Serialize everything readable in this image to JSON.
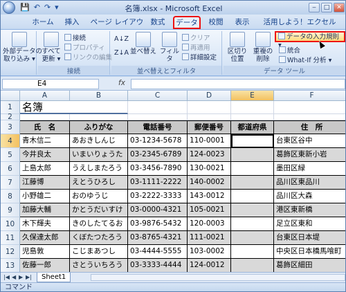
{
  "window": {
    "title": "名簿.xlsx - Microsoft Excel"
  },
  "qat": {
    "save": "💾",
    "undo": "↶",
    "redo": "↷",
    "more": "▾"
  },
  "tabs": [
    "ホーム",
    "挿入",
    "ページ レイアウト",
    "数式",
    "データ",
    "校閲",
    "表示",
    "活用しよう！エクセル"
  ],
  "active_tab_index": 4,
  "ribbon": {
    "groups": {
      "g1_label": "",
      "connections_label": "接続",
      "sort_label": "並べ替えとフィルタ",
      "tools_label": "データ ツール"
    },
    "external_data": "外部データの\n取り込み ▾",
    "refresh_all": "すべて\n更新 ▾",
    "connections": "接続",
    "properties": "プロパティ",
    "edit_links": "リンクの編集",
    "sort_az": "A↓Z",
    "sort_za": "Z↓A",
    "sort": "並べ替え",
    "filter": "フィルタ",
    "clear": "クリア",
    "reapply": "再適用",
    "advanced": "詳細設定",
    "text_to_columns": "区切り位置",
    "remove_dupes": "重複の\n削除",
    "data_validation": "データの入力規則 ▾",
    "consolidate": "統合",
    "whatif": "What-If 分析 ▾"
  },
  "formula_bar": {
    "name_box": "E4",
    "fx": "fx",
    "content": ""
  },
  "columns": [
    "A",
    "B",
    "C",
    "D",
    "E",
    "F"
  ],
  "sheet": {
    "title": "名簿",
    "headers": [
      "氏　名",
      "ふりがな",
      "電話番号",
      "郵便番号",
      "都道府県",
      "住　所"
    ],
    "rows": [
      [
        "青木信二",
        "あおきしんじ",
        "03-1234-5678",
        "110-0001",
        "",
        "台東区谷中"
      ],
      [
        "今井良太",
        "いまいりょうた",
        "03-2345-6789",
        "124-0023",
        "",
        "葛飾区東新小岩"
      ],
      [
        "上島太郎",
        "うえしまたろう",
        "03-3456-7890",
        "130-0021",
        "",
        "墨田区緑"
      ],
      [
        "江藤博",
        "えとうひろし",
        "03-1111-2222",
        "140-0002",
        "",
        "品川区東品川"
      ],
      [
        "小野雄二",
        "おのゆうじ",
        "03-2222-3333",
        "143-0012",
        "",
        "品川区大森"
      ],
      [
        "加藤大輔",
        "かとうだいすけ",
        "03-0000-4321",
        "105-0021",
        "",
        "港区東新橋"
      ],
      [
        "木下輝夫",
        "きのしたてるお",
        "03-9876-5432",
        "120-0003",
        "",
        "足立区東和"
      ],
      [
        "久保達太郎",
        "くぼたつたろう",
        "03-8765-4321",
        "111-0021",
        "",
        "台東区日本堤"
      ],
      [
        "児島敦",
        "こじまあつし",
        "03-4444-5555",
        "103-0002",
        "",
        "中央区日本橋馬喰町"
      ],
      [
        "佐藤一郎",
        "さとういちろう",
        "03-3333-4444",
        "124-0012",
        "",
        "葛飾区細田"
      ]
    ]
  },
  "sheet_tabs": [
    "Sheet1"
  ],
  "status": "コマンド"
}
